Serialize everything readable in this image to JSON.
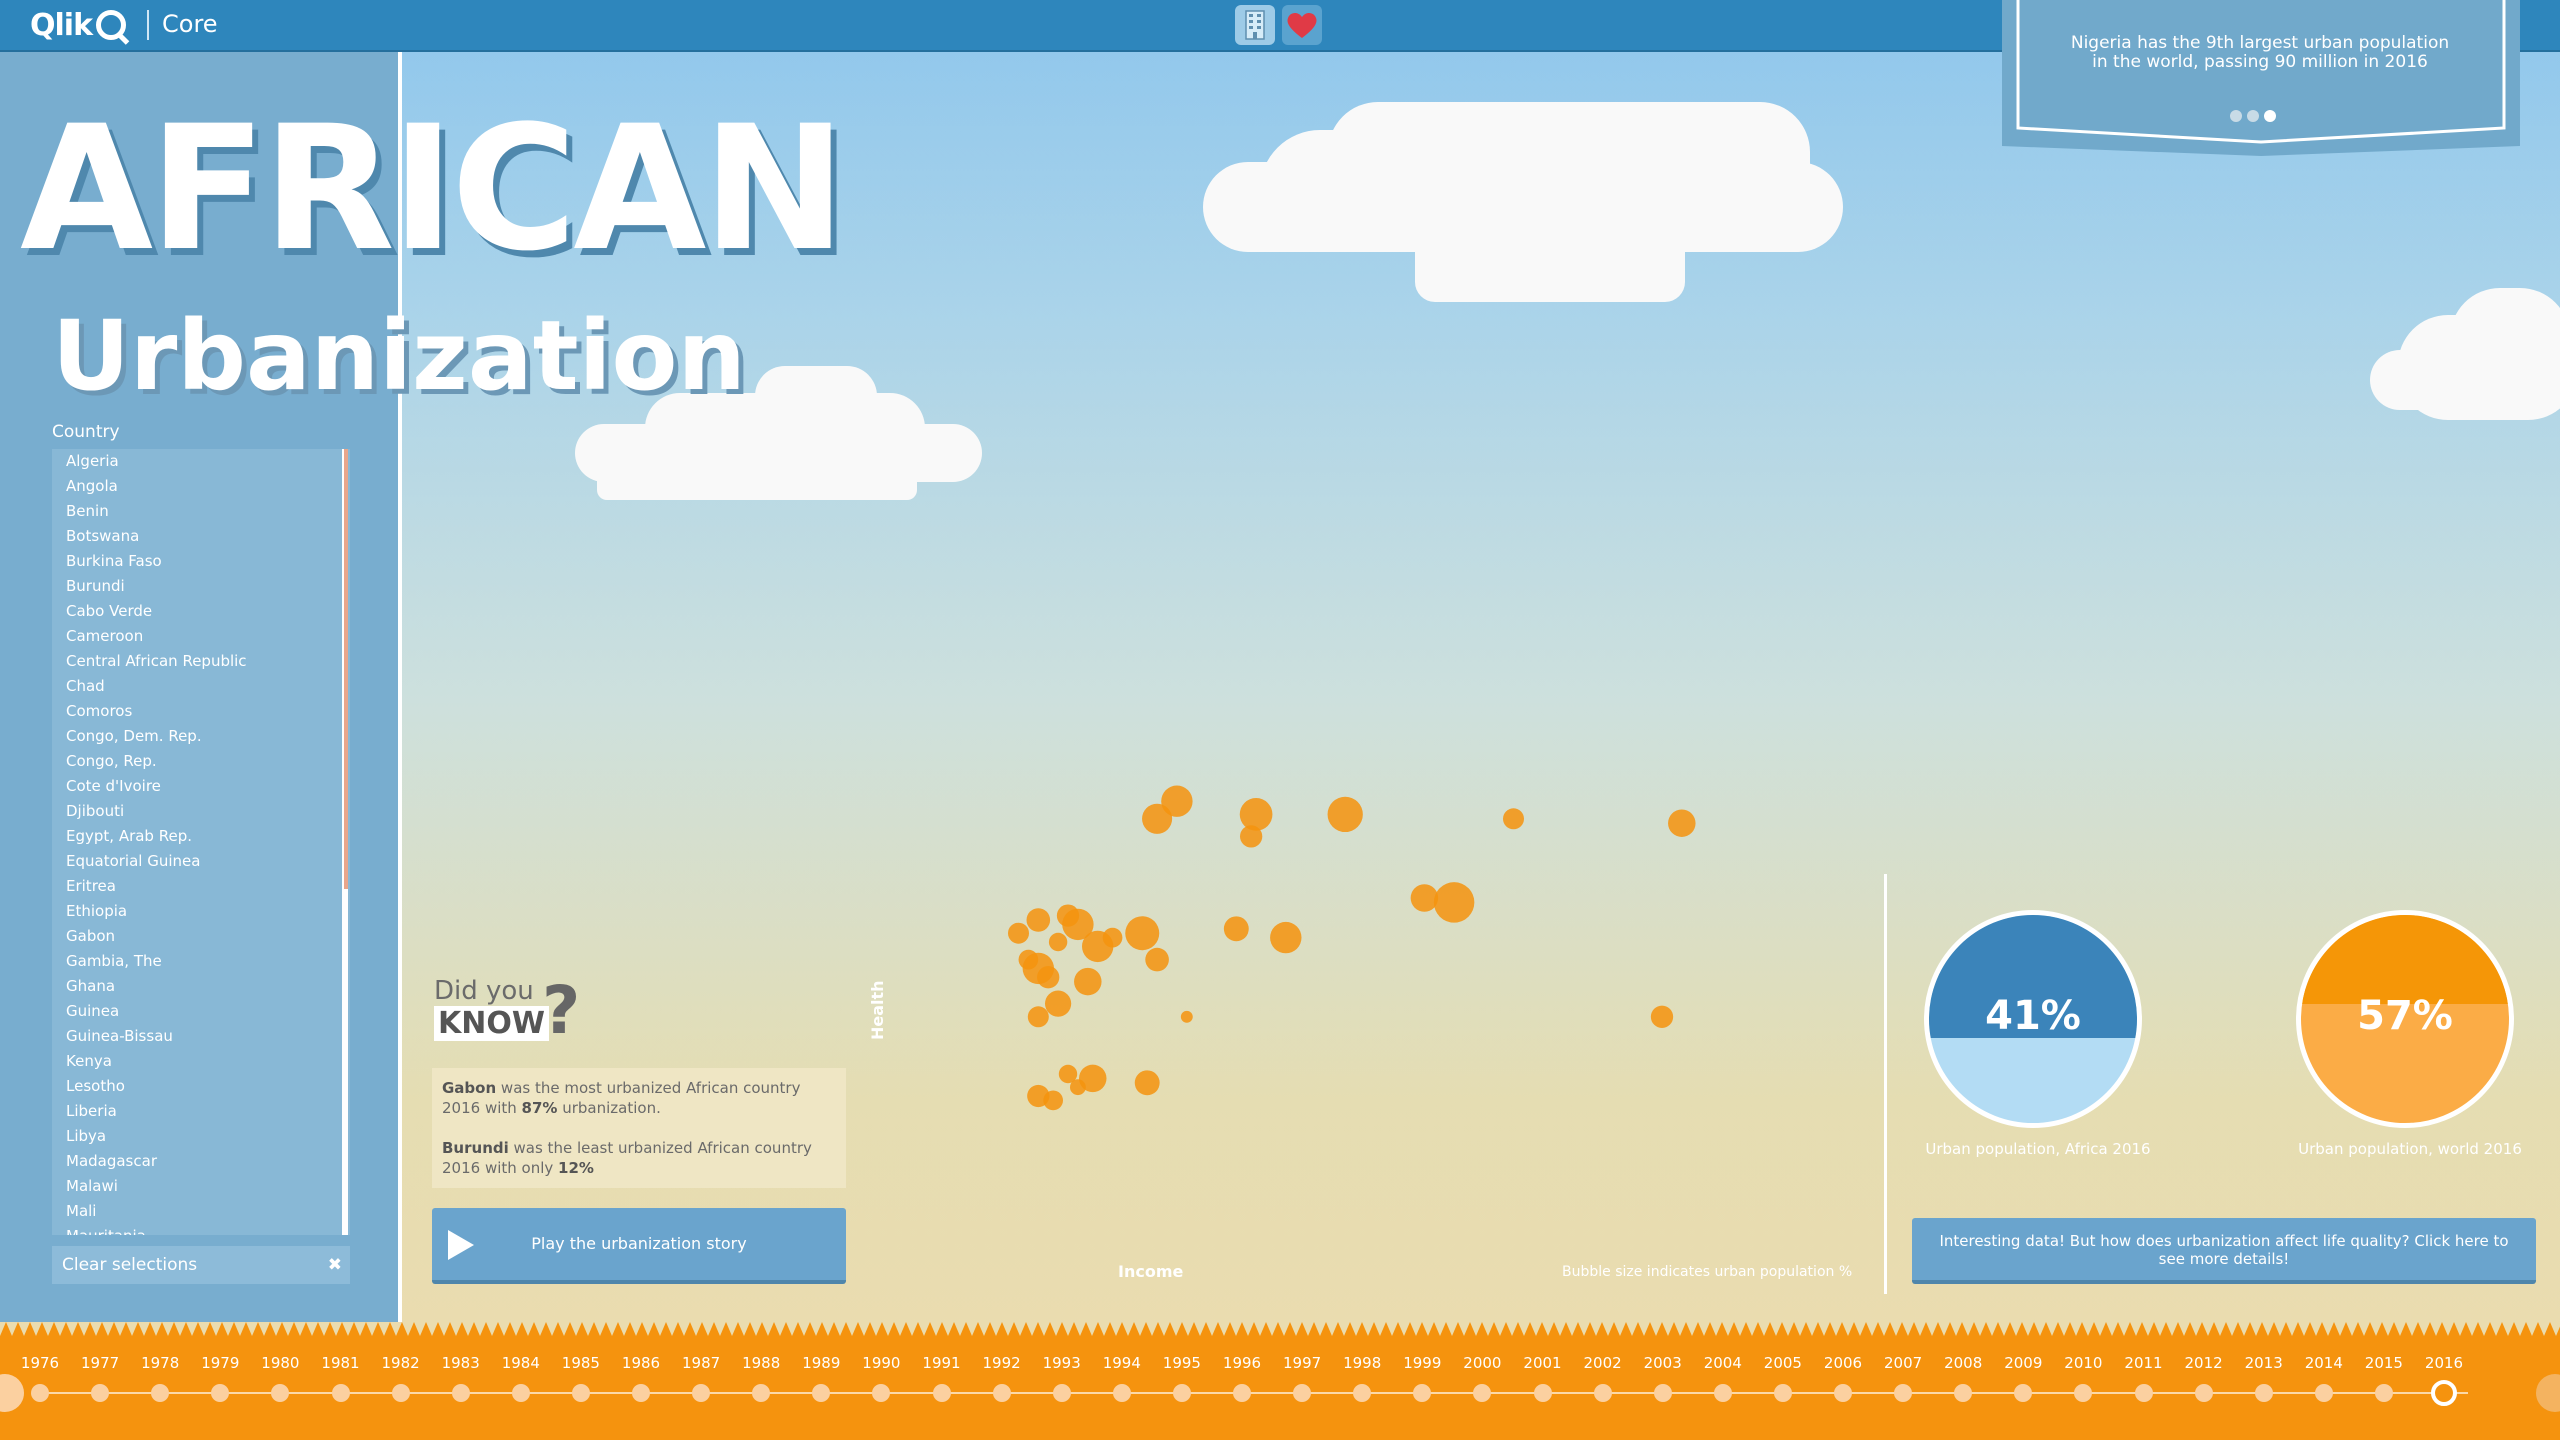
{
  "topbar": {
    "logo_text": "Qlik",
    "app_name": "Core",
    "building_icon": "building-icon",
    "heart_icon": "heart-icon",
    "accent_color": "#2e86bc"
  },
  "ribbon": {
    "text": "Nigeria has the 9th largest urban population in the world, passing 90 million in 2016",
    "dots_total": 3,
    "active_dot": 3
  },
  "title": {
    "main": "AFRICAN",
    "sub": "Urbanization"
  },
  "filter": {
    "label": "Country",
    "countries": [
      "Algeria",
      "Angola",
      "Benin",
      "Botswana",
      "Burkina Faso",
      "Burundi",
      "Cabo Verde",
      "Cameroon",
      "Central African Republic",
      "Chad",
      "Comoros",
      "Congo, Dem. Rep.",
      "Congo, Rep.",
      "Cote d'Ivoire",
      "Djibouti",
      "Egypt, Arab Rep.",
      "Equatorial Guinea",
      "Eritrea",
      "Ethiopia",
      "Gabon",
      "Gambia, The",
      "Ghana",
      "Guinea",
      "Guinea-Bissau",
      "Kenya",
      "Lesotho",
      "Liberia",
      "Libya",
      "Madagascar",
      "Malawi",
      "Mali",
      "Mauritania"
    ],
    "clear_label": "Clear selections",
    "clear_icon": "✖"
  },
  "did_you_know": {
    "line1": "Did you",
    "line2": "KNOW",
    "q": "?",
    "fact1": {
      "country": "Gabon",
      "pre": " was the most urbanized African country 2016 with ",
      "pct": "87%",
      "post": " urbanization."
    },
    "fact2": {
      "country": "Burundi",
      "pre": " was the least urbanized African country 2016 with only ",
      "pct": "12%",
      "post": ""
    }
  },
  "play": {
    "label": "Play the urbanization story",
    "icon": "play-icon"
  },
  "chart": {
    "x_label": "Income",
    "y_label": "Health",
    "bubble_note": "Bubble size indicates urban population %"
  },
  "chart_data": {
    "type": "scatter",
    "xlabel": "Income",
    "ylabel": "Health",
    "color": "#f5930e",
    "points": [
      {
        "x": 0.15,
        "y": 0.72,
        "s": 0.5
      },
      {
        "x": 0.17,
        "y": 0.75,
        "s": 0.6
      },
      {
        "x": 0.2,
        "y": 0.76,
        "s": 0.55
      },
      {
        "x": 0.21,
        "y": 0.74,
        "s": 0.9
      },
      {
        "x": 0.18,
        "y": 0.62,
        "s": 0.55
      },
      {
        "x": 0.16,
        "y": 0.66,
        "s": 0.45
      },
      {
        "x": 0.17,
        "y": 0.64,
        "s": 0.9
      },
      {
        "x": 0.19,
        "y": 0.7,
        "s": 0.4
      },
      {
        "x": 0.23,
        "y": 0.69,
        "s": 0.9
      },
      {
        "x": 0.245,
        "y": 0.71,
        "s": 0.45
      },
      {
        "x": 0.275,
        "y": 0.72,
        "s": 1.0
      },
      {
        "x": 0.29,
        "y": 0.66,
        "s": 0.6
      },
      {
        "x": 0.17,
        "y": 0.53,
        "s": 0.5
      },
      {
        "x": 0.19,
        "y": 0.56,
        "s": 0.7
      },
      {
        "x": 0.22,
        "y": 0.61,
        "s": 0.75
      },
      {
        "x": 0.2,
        "y": 0.4,
        "s": 0.4
      },
      {
        "x": 0.225,
        "y": 0.39,
        "s": 0.75
      },
      {
        "x": 0.17,
        "y": 0.35,
        "s": 0.55
      },
      {
        "x": 0.185,
        "y": 0.34,
        "s": 0.45
      },
      {
        "x": 0.21,
        "y": 0.37,
        "s": 0.3
      },
      {
        "x": 0.28,
        "y": 0.38,
        "s": 0.65
      },
      {
        "x": 0.32,
        "y": 0.53,
        "s": 0.15
      },
      {
        "x": 0.29,
        "y": 0.98,
        "s": 0.85
      },
      {
        "x": 0.31,
        "y": 1.02,
        "s": 0.9
      },
      {
        "x": 0.39,
        "y": 0.99,
        "s": 0.95
      },
      {
        "x": 0.385,
        "y": 0.94,
        "s": 0.55
      },
      {
        "x": 0.37,
        "y": 0.73,
        "s": 0.65
      },
      {
        "x": 0.42,
        "y": 0.71,
        "s": 0.9
      },
      {
        "x": 0.48,
        "y": 0.99,
        "s": 1.05
      },
      {
        "x": 0.56,
        "y": 0.8,
        "s": 0.75
      },
      {
        "x": 0.59,
        "y": 0.79,
        "s": 1.25
      },
      {
        "x": 0.65,
        "y": 0.98,
        "s": 0.5
      },
      {
        "x": 0.8,
        "y": 0.53,
        "s": 0.55
      },
      {
        "x": 0.82,
        "y": 0.97,
        "s": 0.75
      }
    ]
  },
  "pies": {
    "africa": {
      "value": "41%",
      "fraction": 0.41,
      "caption": "Urban population, Africa 2016",
      "color": "#3b84ba"
    },
    "world": {
      "value": "57%",
      "fraction": 0.57,
      "caption": "Urban population, world 2016",
      "color": "#f59607"
    }
  },
  "details": {
    "label": "Interesting data! But how does urbanization affect life quality? Click here to see more details!"
  },
  "timeline": {
    "years": [
      "1976",
      "1977",
      "1978",
      "1979",
      "1980",
      "1981",
      "1982",
      "1983",
      "1984",
      "1985",
      "1986",
      "1987",
      "1988",
      "1989",
      "1990",
      "1991",
      "1992",
      "1993",
      "1994",
      "1995",
      "1996",
      "1997",
      "1998",
      "1999",
      "2000",
      "2001",
      "2002",
      "2003",
      "2004",
      "2005",
      "2006",
      "2007",
      "2008",
      "2009",
      "2010",
      "2011",
      "2012",
      "2013",
      "2014",
      "2015",
      "2016"
    ],
    "selected": "2016"
  }
}
